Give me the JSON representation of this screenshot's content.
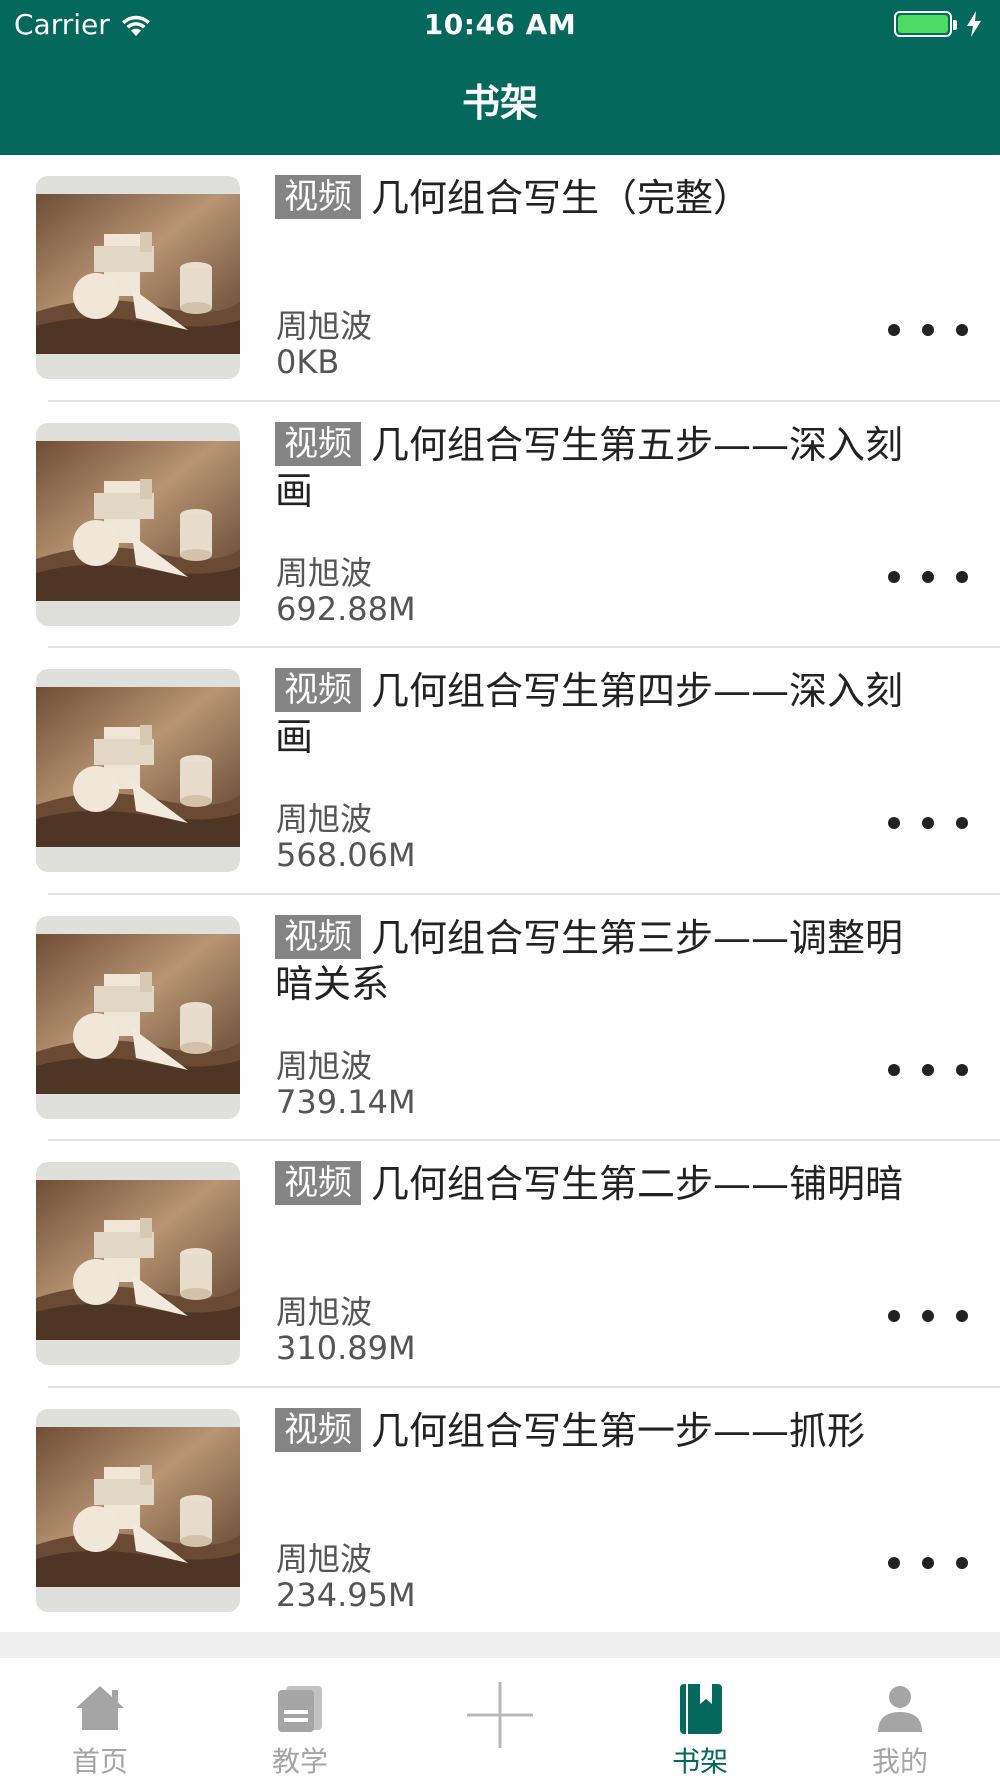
{
  "status_bar": {
    "carrier": "Carrier",
    "time": "10:46 AM",
    "battery_level": 1.0
  },
  "nav": {
    "title": "书架"
  },
  "items": [
    {
      "badge": "视频",
      "title": "几何组合写生（完整）",
      "author": "周旭波",
      "size": "0KB"
    },
    {
      "badge": "视频",
      "title": "几何组合写生第五步——深入刻画",
      "author": "周旭波",
      "size": "692.88M"
    },
    {
      "badge": "视频",
      "title": "几何组合写生第四步——深入刻画",
      "author": "周旭波",
      "size": "568.06M"
    },
    {
      "badge": "视频",
      "title": "几何组合写生第三步——调整明暗关系",
      "author": "周旭波",
      "size": "739.14M"
    },
    {
      "badge": "视频",
      "title": "几何组合写生第二步——铺明暗",
      "author": "周旭波",
      "size": "310.89M"
    },
    {
      "badge": "视频",
      "title": "几何组合写生第一步——抓形",
      "author": "周旭波",
      "size": "234.95M"
    }
  ],
  "tabs": [
    {
      "label": "首页",
      "icon": "home-icon",
      "active": false
    },
    {
      "label": "教学",
      "icon": "teaching-icon",
      "active": false
    },
    {
      "label": "",
      "icon": "plus-icon",
      "active": false
    },
    {
      "label": "书架",
      "icon": "bookshelf-icon",
      "active": true
    },
    {
      "label": "我的",
      "icon": "profile-icon",
      "active": false
    }
  ],
  "colors": {
    "brand": "#05685c",
    "badge_bg": "#848484",
    "inactive_tab": "#a5a5a5",
    "battery": "#4cd964"
  }
}
